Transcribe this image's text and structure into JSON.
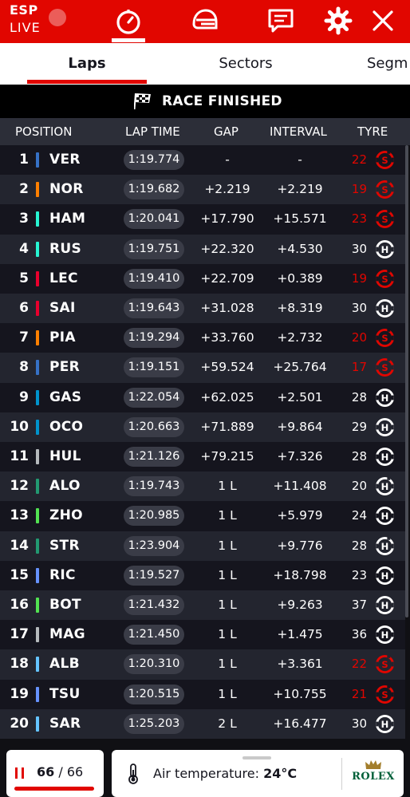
{
  "header": {
    "country": "ESP",
    "live_label": "LIVE",
    "icons": [
      "live-dot-icon",
      "timer-icon",
      "helmet-icon",
      "race-control-icon",
      "settings-icon",
      "close-icon"
    ]
  },
  "tabs": [
    {
      "label": "Laps",
      "active": true
    },
    {
      "label": "Sectors",
      "active": false
    },
    {
      "label": "Segm",
      "active": false
    }
  ],
  "banner": {
    "text": "RACE FINISHED",
    "icon": "chequered-flag-icon"
  },
  "columns": {
    "position": "POSITION",
    "lap_time": "LAP TIME",
    "gap": "GAP",
    "interval": "INTERVAL",
    "tyre": "TYRE"
  },
  "rows": [
    {
      "pos": "1",
      "code": "VER",
      "team_color": "#3671c6",
      "lap": "1:19.774",
      "gap": "-",
      "interval": "-",
      "tyre_age": "22",
      "tyre": "S",
      "new_tyre": false
    },
    {
      "pos": "2",
      "code": "NOR",
      "team_color": "#ff8000",
      "lap": "1:19.682",
      "gap": "+2.219",
      "interval": "+2.219",
      "tyre_age": "19",
      "tyre": "S",
      "new_tyre": false
    },
    {
      "pos": "3",
      "code": "HAM",
      "team_color": "#27f4d2",
      "lap": "1:20.041",
      "gap": "+17.790",
      "interval": "+15.571",
      "tyre_age": "23",
      "tyre": "S",
      "new_tyre": false
    },
    {
      "pos": "4",
      "code": "RUS",
      "team_color": "#27f4d2",
      "lap": "1:19.751",
      "gap": "+22.320",
      "interval": "+4.530",
      "tyre_age": "30",
      "tyre": "H",
      "new_tyre": true
    },
    {
      "pos": "5",
      "code": "LEC",
      "team_color": "#e8002d",
      "lap": "1:19.410",
      "gap": "+22.709",
      "interval": "+0.389",
      "tyre_age": "19",
      "tyre": "S",
      "new_tyre": false
    },
    {
      "pos": "6",
      "code": "SAI",
      "team_color": "#e8002d",
      "lap": "1:19.643",
      "gap": "+31.028",
      "interval": "+8.319",
      "tyre_age": "30",
      "tyre": "H",
      "new_tyre": true
    },
    {
      "pos": "7",
      "code": "PIA",
      "team_color": "#ff8000",
      "lap": "1:19.294",
      "gap": "+33.760",
      "interval": "+2.732",
      "tyre_age": "20",
      "tyre": "S",
      "new_tyre": false
    },
    {
      "pos": "8",
      "code": "PER",
      "team_color": "#3671c6",
      "lap": "1:19.151",
      "gap": "+59.524",
      "interval": "+25.764",
      "tyre_age": "17",
      "tyre": "S",
      "new_tyre": false
    },
    {
      "pos": "9",
      "code": "GAS",
      "team_color": "#0093cc",
      "lap": "1:22.054",
      "gap": "+62.025",
      "interval": "+2.501",
      "tyre_age": "28",
      "tyre": "H",
      "new_tyre": true
    },
    {
      "pos": "10",
      "code": "OCO",
      "team_color": "#0093cc",
      "lap": "1:20.663",
      "gap": "+71.889",
      "interval": "+9.864",
      "tyre_age": "29",
      "tyre": "H",
      "new_tyre": true
    },
    {
      "pos": "11",
      "code": "HUL",
      "team_color": "#b6babd",
      "lap": "1:21.126",
      "gap": "+79.215",
      "interval": "+7.326",
      "tyre_age": "28",
      "tyre": "H",
      "new_tyre": true
    },
    {
      "pos": "12",
      "code": "ALO",
      "team_color": "#229971",
      "lap": "1:19.743",
      "gap": "1 L",
      "interval": "+11.408",
      "tyre_age": "20",
      "tyre": "H",
      "new_tyre": false
    },
    {
      "pos": "13",
      "code": "ZHO",
      "team_color": "#52e252",
      "lap": "1:20.985",
      "gap": "1 L",
      "interval": "+5.979",
      "tyre_age": "24",
      "tyre": "H",
      "new_tyre": true
    },
    {
      "pos": "14",
      "code": "STR",
      "team_color": "#229971",
      "lap": "1:23.904",
      "gap": "1 L",
      "interval": "+9.776",
      "tyre_age": "28",
      "tyre": "H",
      "new_tyre": false
    },
    {
      "pos": "15",
      "code": "RIC",
      "team_color": "#6692ff",
      "lap": "1:19.527",
      "gap": "1 L",
      "interval": "+18.798",
      "tyre_age": "23",
      "tyre": "H",
      "new_tyre": true
    },
    {
      "pos": "16",
      "code": "BOT",
      "team_color": "#52e252",
      "lap": "1:21.432",
      "gap": "1 L",
      "interval": "+9.263",
      "tyre_age": "37",
      "tyre": "H",
      "new_tyre": true
    },
    {
      "pos": "17",
      "code": "MAG",
      "team_color": "#b6babd",
      "lap": "1:21.450",
      "gap": "1 L",
      "interval": "+1.475",
      "tyre_age": "36",
      "tyre": "H",
      "new_tyre": true
    },
    {
      "pos": "18",
      "code": "ALB",
      "team_color": "#64c4ff",
      "lap": "1:20.310",
      "gap": "1 L",
      "interval": "+3.361",
      "tyre_age": "22",
      "tyre": "S",
      "new_tyre": false
    },
    {
      "pos": "19",
      "code": "TSU",
      "team_color": "#6692ff",
      "lap": "1:20.515",
      "gap": "1 L",
      "interval": "+10.755",
      "tyre_age": "21",
      "tyre": "S",
      "new_tyre": false
    },
    {
      "pos": "20",
      "code": "SAR",
      "team_color": "#64c4ff",
      "lap": "1:25.203",
      "gap": "2 L",
      "interval": "+16.477",
      "tyre_age": "30",
      "tyre": "H",
      "new_tyre": true
    }
  ],
  "tyre_colors": {
    "S": "#e10600",
    "H": "#ffffff"
  },
  "footer": {
    "lap_current": "66",
    "lap_separator": "/",
    "lap_total": "66",
    "lap_progress": 1.0,
    "air_label": "Air temperature:",
    "air_value": "24°C",
    "sponsor": "ROLEX"
  }
}
